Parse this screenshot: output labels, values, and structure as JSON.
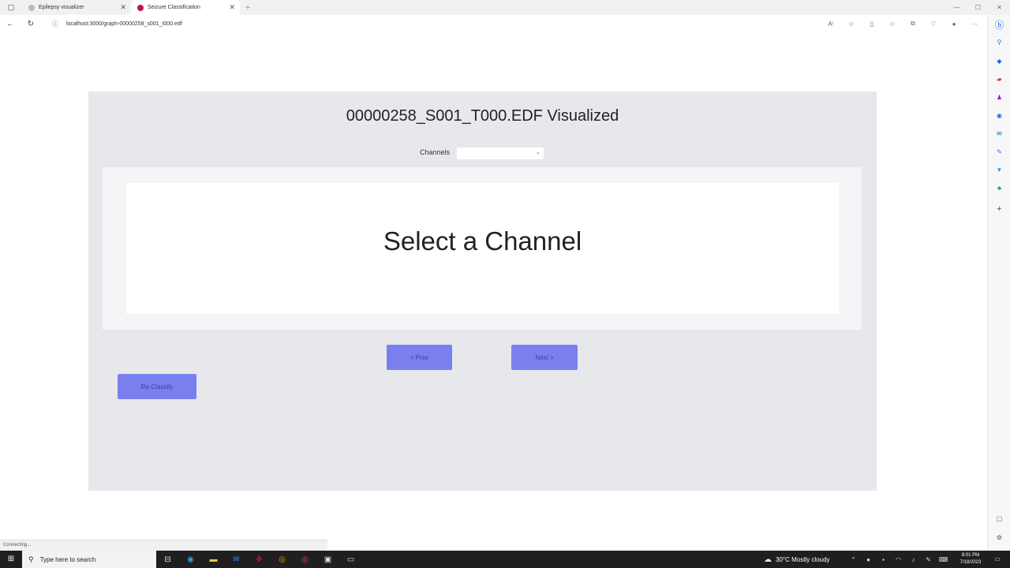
{
  "browser": {
    "tabs": [
      {
        "title": "Epilepsy visualizer",
        "close": "✕"
      },
      {
        "title": "Seizure Classification",
        "close": "✕"
      }
    ],
    "new_tab": "+",
    "window_controls": {
      "minimize": "—",
      "maximize": "☐",
      "close": "✕"
    },
    "url": "localhost:3000/graph-00000258_s001_t000.edf",
    "status_text": "Connecting..."
  },
  "page": {
    "title": "00000258_S001_T000.EDF Visualized",
    "channels_label": "Channels",
    "channel_selected": "",
    "placeholder_message": "Select a Channel",
    "prev_button": "< Prev",
    "next_button": "Next >",
    "reclassify_button": "Re-Classify"
  },
  "taskbar": {
    "search_placeholder": "Type here to search",
    "weather": "30°C  Mostly cloudy",
    "time": "8:01 PM",
    "date": "7/18/2023"
  },
  "colors": {
    "accent_button": "#7a7ff0",
    "panel_bg": "#e7e8ec"
  }
}
